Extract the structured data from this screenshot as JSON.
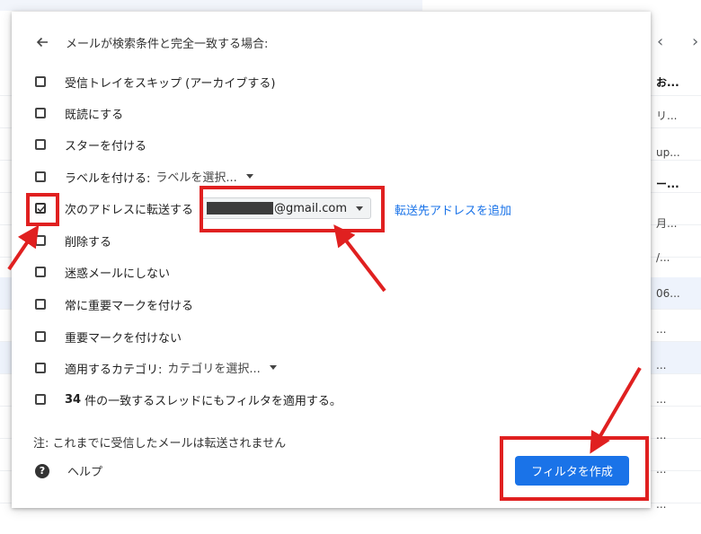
{
  "background": {
    "rows": [
      {
        "text": "お...",
        "bold": true
      },
      {
        "text": "リ...",
        "bold": false
      },
      {
        "text": "up...",
        "bold": false
      },
      {
        "text": "ー...",
        "bold": true
      },
      {
        "text": "月...",
        "bold": false
      },
      {
        "text": "/...",
        "bold": false
      },
      {
        "text": "06...",
        "bold": false
      },
      {
        "text": "...",
        "bold": false
      },
      {
        "text": "...",
        "bold": false
      },
      {
        "text": "...",
        "bold": false
      },
      {
        "text": "...",
        "bold": false
      },
      {
        "text": "...",
        "bold": false
      },
      {
        "text": "...",
        "bold": false
      }
    ],
    "pager_prev": "‹",
    "pager_next": "›"
  },
  "dialog": {
    "title": "メールが検索条件と完全一致する場合:",
    "options": [
      {
        "label": "受信トレイをスキップ (アーカイブする)",
        "checked": false
      },
      {
        "label": "既読にする",
        "checked": false
      },
      {
        "label": "スターを付ける",
        "checked": false
      },
      {
        "label": "ラベルを付ける:",
        "checked": false,
        "dropdown": "ラベルを選択..."
      },
      {
        "label": "次のアドレスに転送する",
        "checked": true,
        "email_suffix": "@gmail.com",
        "link": "転送先アドレスを追加"
      },
      {
        "label": "削除する",
        "checked": false
      },
      {
        "label": "迷惑メールにしない",
        "checked": false
      },
      {
        "label": "常に重要マークを付ける",
        "checked": false
      },
      {
        "label": "重要マークを付けない",
        "checked": false
      },
      {
        "label": "適用するカテゴリ:",
        "checked": false,
        "dropdown": "カテゴリを選択..."
      },
      {
        "count": "34",
        "label": "件の一致するスレッドにもフィルタを適用する。",
        "checked": false
      }
    ],
    "note": "注: これまでに受信したメールは転送されません",
    "help_label": "ヘルプ",
    "create_button": "フィルタを作成"
  },
  "colors": {
    "primary_button": "#1a73e8",
    "link": "#1a73e8",
    "annotation": "#e02020"
  }
}
